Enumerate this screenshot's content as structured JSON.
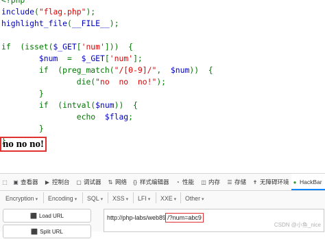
{
  "code": {
    "lines": [
      [
        {
          "c": "k",
          "t": "<?php"
        }
      ],
      [
        {
          "c": "v",
          "t": "include"
        },
        {
          "c": "k",
          "t": "("
        },
        {
          "c": "s",
          "t": "\"flag.php\""
        },
        {
          "c": "k",
          "t": ");"
        }
      ],
      [
        {
          "c": "v",
          "t": "highlight_file"
        },
        {
          "c": "k",
          "t": "("
        },
        {
          "c": "v",
          "t": "__FILE__"
        },
        {
          "c": "k",
          "t": ");"
        }
      ],
      [],
      [
        {
          "c": "k",
          "t": "if  (isset("
        },
        {
          "c": "v",
          "t": "$_GET"
        },
        {
          "c": "k",
          "t": "["
        },
        {
          "c": "s",
          "t": "'num'"
        },
        {
          "c": "k",
          "t": "]))  {"
        }
      ],
      [
        {
          "c": "k",
          "t": "        "
        },
        {
          "c": "v",
          "t": "$num"
        },
        {
          "c": "k",
          "t": "  =  "
        },
        {
          "c": "v",
          "t": "$_GET"
        },
        {
          "c": "k",
          "t": "["
        },
        {
          "c": "s",
          "t": "'num'"
        },
        {
          "c": "k",
          "t": "];"
        }
      ],
      [
        {
          "c": "k",
          "t": "        if  (preg_match("
        },
        {
          "c": "s",
          "t": "\"/[0-9]/\""
        },
        {
          "c": "k",
          "t": ",  "
        },
        {
          "c": "v",
          "t": "$num"
        },
        {
          "c": "k",
          "t": "))  {"
        }
      ],
      [
        {
          "c": "k",
          "t": "                die("
        },
        {
          "c": "s",
          "t": "\"no  no  no!\""
        },
        {
          "c": "k",
          "t": ");"
        }
      ],
      [
        {
          "c": "k",
          "t": "        }"
        }
      ],
      [
        {
          "c": "k",
          "t": "        if  (intval("
        },
        {
          "c": "v",
          "t": "$num"
        },
        {
          "c": "k",
          "t": "))  {"
        }
      ],
      [
        {
          "c": "k",
          "t": "                echo  "
        },
        {
          "c": "v",
          "t": "$flag"
        },
        {
          "c": "k",
          "t": ";"
        }
      ],
      [
        {
          "c": "k",
          "t": "        }"
        }
      ],
      [
        {
          "c": "k",
          "t": "}"
        }
      ]
    ]
  },
  "output_text": "no no no!",
  "devtools": {
    "tabs": [
      {
        "icon": "cursor",
        "label": ""
      },
      {
        "icon": "inspector",
        "label": "查看器"
      },
      {
        "icon": "console",
        "label": "控制台"
      },
      {
        "icon": "debugger",
        "label": "调试器"
      },
      {
        "icon": "network",
        "label": "网络"
      },
      {
        "icon": "style-editor",
        "label": "样式编辑器"
      },
      {
        "icon": "performance",
        "label": "性能"
      },
      {
        "icon": "memory",
        "label": "内存"
      },
      {
        "icon": "storage",
        "label": "存储"
      },
      {
        "icon": "accessibility",
        "label": "无障碍环境"
      },
      {
        "icon": "hackbar",
        "label": "HackBar"
      }
    ],
    "menus": [
      "Encryption",
      "Encoding",
      "SQL",
      "XSS",
      "LFI",
      "XXE",
      "Other"
    ],
    "load_url_label": "Load URL",
    "split_url_label": "Split URL",
    "url_base": "http://php-labs/web89",
    "url_query": "/?num=abc9"
  },
  "watermark": "CSDN @小鱼_nice",
  "colors": {
    "keyword": "#007700",
    "string": "#DD0000",
    "variable": "#0000BB",
    "highlight_border": "#e03030",
    "active_tab": "#0a84ff"
  }
}
